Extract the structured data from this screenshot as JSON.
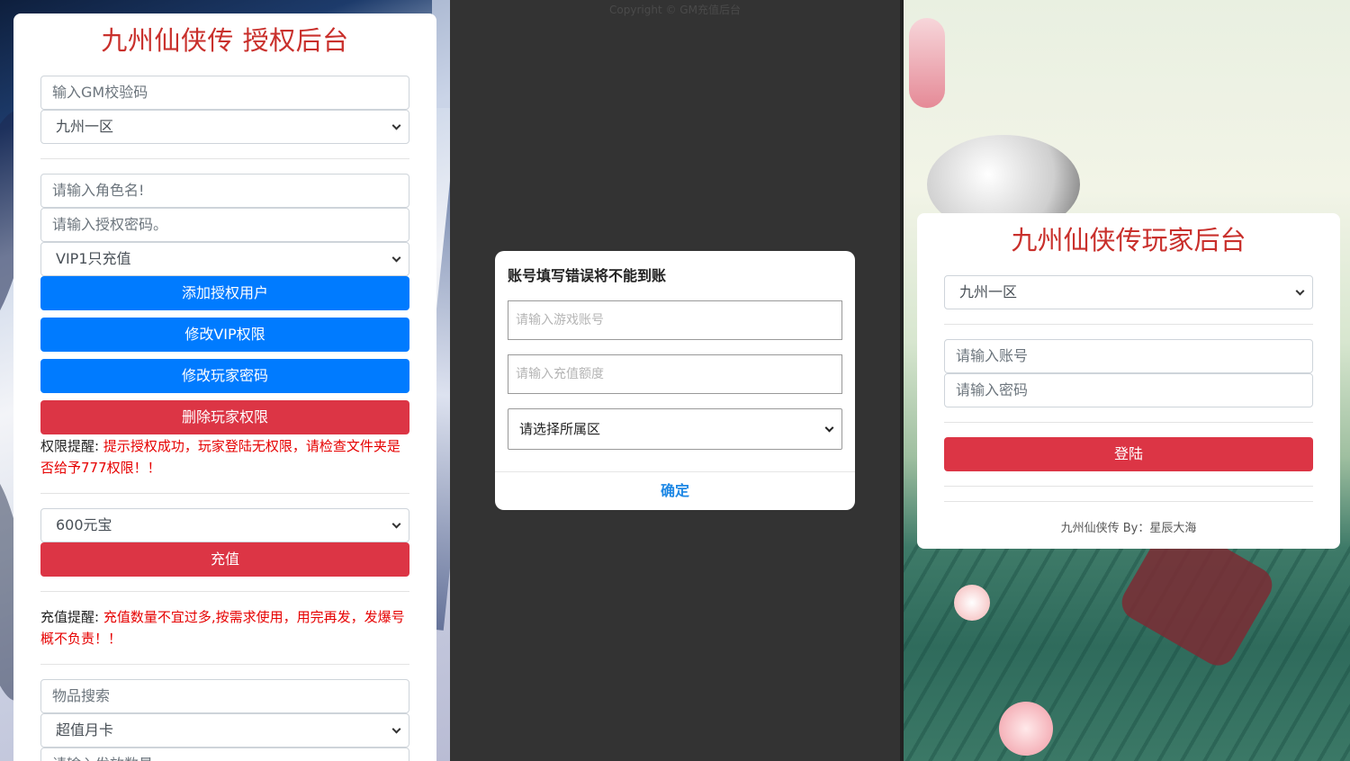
{
  "admin": {
    "title": "九州仙侠传 授权后台",
    "gm_code_placeholder": "输入GM校验码",
    "server_select": "九州一区",
    "role_name_placeholder": "请输入角色名!",
    "auth_password_placeholder": "请输入授权密码。",
    "vip_select": "VIP1只充值",
    "add_auth_user_label": "添加授权用户",
    "modify_vip_label": "修改VIP权限",
    "modify_password_label": "修改玩家密码",
    "delete_permission_label": "删除玩家权限",
    "permission_note_label": "权限提醒:",
    "permission_note_text": "提示授权成功，玩家登陆无权限，请检查文件夹是否给予777权限！！",
    "amount_select": "600元宝",
    "recharge_label": "充值",
    "recharge_note_label": "充值提醒:",
    "recharge_note_text": "充值数量不宜过多,按需求使用，用完再发，发爆号概不负责！！",
    "item_search_placeholder": "物品搜索",
    "item_select": "超值月卡",
    "send_qty_placeholder": "请输入发放数量"
  },
  "recharge": {
    "copyright": "Copyright © GM充值后台",
    "dialog_title": "账号填写错误将不能到账",
    "account_placeholder": "请输入游戏账号",
    "amount_placeholder": "请输入充值额度",
    "zone_select": "请选择所属区",
    "confirm_label": "确定"
  },
  "player": {
    "title": "九州仙侠传玩家后台",
    "server_select": "九州一区",
    "account_placeholder": "请输入账号",
    "password_placeholder": "请输入密码",
    "login_label": "登陆",
    "footer": "九州仙侠传 By：星辰大海"
  },
  "colors": {
    "title_red": "#c9302c",
    "primary_blue": "#007bff",
    "danger_red": "#dc3545",
    "note_red": "#e60000",
    "confirm_blue": "#1e88e5"
  }
}
